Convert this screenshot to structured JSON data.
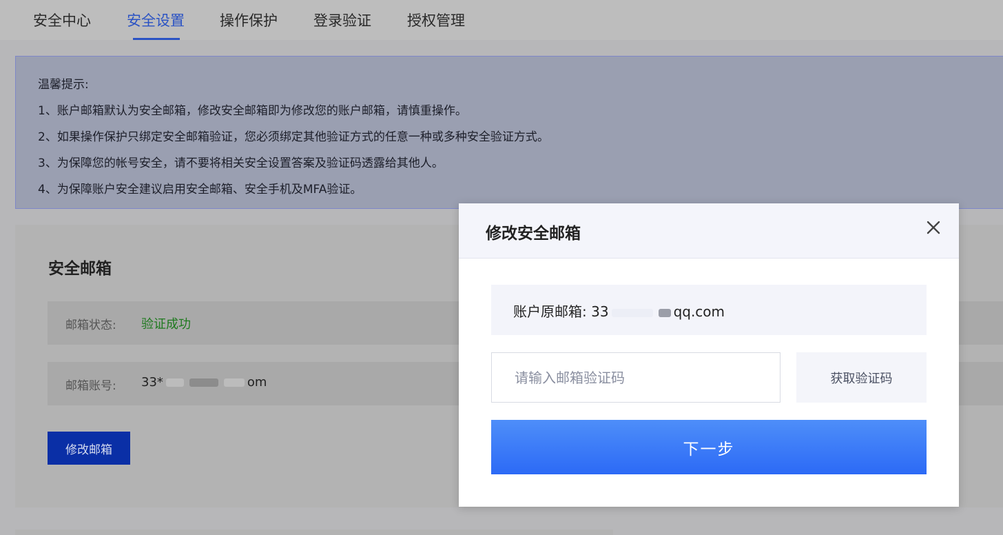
{
  "tabs": [
    {
      "label": "安全中心",
      "active": false
    },
    {
      "label": "安全设置",
      "active": true
    },
    {
      "label": "操作保护",
      "active": false
    },
    {
      "label": "登录验证",
      "active": false
    },
    {
      "label": "授权管理",
      "active": false
    }
  ],
  "notice": {
    "title": "温馨提示:",
    "lines": [
      "1、账户邮箱默认为安全邮箱，修改安全邮箱即为修改您的账户邮箱，请慎重操作。",
      "2、如果操作保护只绑定安全邮箱验证，您必须绑定其他验证方式的任意一种或多种安全验证方式。",
      "3、为保障您的帐号安全，请不要将相关安全设置答案及验证码透露给其他人。",
      "4、为保障账户安全建议启用安全邮箱、安全手机及MFA验证。"
    ]
  },
  "email_card": {
    "title": "安全邮箱",
    "status_label": "邮箱状态:",
    "status_value": "验证成功",
    "account_label": "邮箱账号:",
    "account_prefix": "33*",
    "account_suffix": "om",
    "edit_button": "修改邮箱"
  },
  "modal": {
    "title": "修改安全邮箱",
    "original_label": "账户原邮箱:",
    "original_prefix": "33",
    "original_suffix": "qq.com",
    "code_placeholder": "请输入邮箱验证码",
    "get_code_button": "获取验证码",
    "next_button": "下一步"
  },
  "colors": {
    "accent": "#2b53c4",
    "primary_button": "#2c6af6",
    "success": "#1f7a1f"
  },
  "icons": {
    "close": "close-icon"
  }
}
